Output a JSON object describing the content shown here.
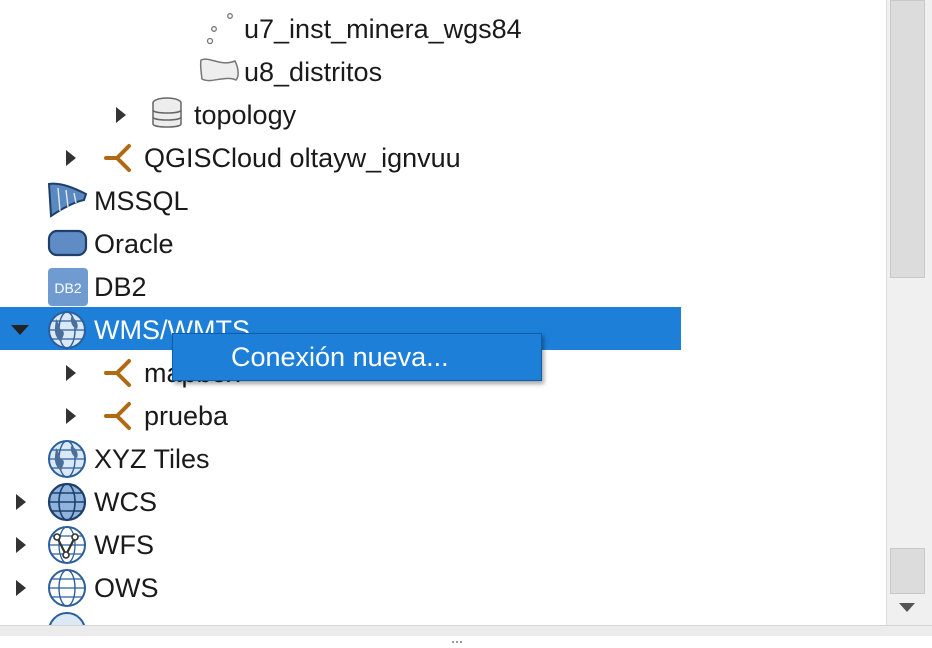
{
  "tree": {
    "items": [
      {
        "name": "u7-inst-minera-item",
        "label": "u7_inst_minera_wgs84",
        "icon": "point-layer-icon"
      },
      {
        "name": "u8-distritos-item",
        "label": "u8_distritos",
        "icon": "polygon-layer-icon"
      },
      {
        "name": "topology-item",
        "label": "topology",
        "icon": "database-schema-icon"
      },
      {
        "name": "qgiscloud-item",
        "label": "QGISCloud oltayw_ignvuu",
        "icon": "connection-icon"
      },
      {
        "name": "mssql-item",
        "label": "MSSQL",
        "icon": "mssql-icon"
      },
      {
        "name": "oracle-item",
        "label": "Oracle",
        "icon": "oracle-icon"
      },
      {
        "name": "db2-item",
        "label": "DB2",
        "icon": "db2-icon",
        "icon_text": "DB2"
      },
      {
        "name": "wms-wmts-item",
        "label": "WMS/WMTS",
        "icon": "globe-icon"
      },
      {
        "name": "mapbox-item",
        "label": "mapbox",
        "icon": "connection-icon"
      },
      {
        "name": "prueba-item",
        "label": "prueba",
        "icon": "connection-icon"
      },
      {
        "name": "xyz-tiles-item",
        "label": "XYZ Tiles",
        "icon": "globe-icon"
      },
      {
        "name": "wcs-item",
        "label": "WCS",
        "icon": "wcs-globe-icon"
      },
      {
        "name": "wfs-item",
        "label": "WFS",
        "icon": "wfs-globe-icon"
      },
      {
        "name": "ows-item",
        "label": "OWS",
        "icon": "ows-globe-icon"
      }
    ]
  },
  "context_menu": {
    "items": [
      {
        "label": "Conexión nueva..."
      }
    ]
  },
  "colors": {
    "selection": "#1e7fd8",
    "connection_icon": "#b06a14",
    "globe_icon": "#2b5f9e"
  }
}
